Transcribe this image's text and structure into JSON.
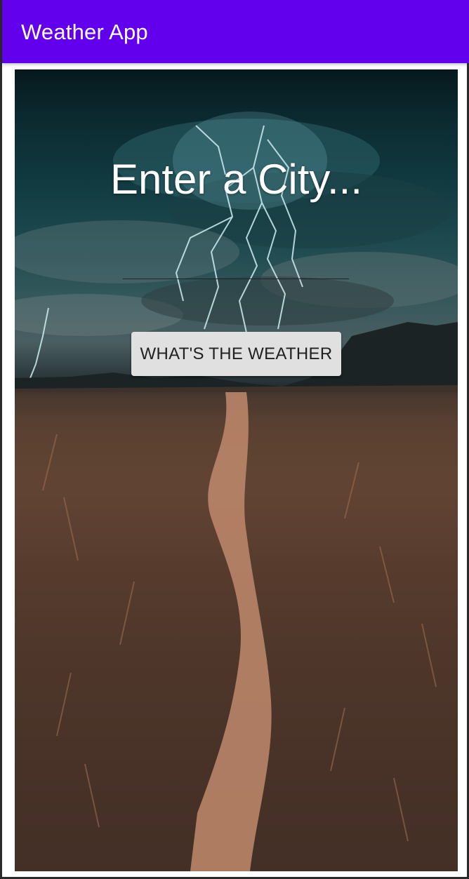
{
  "app_bar": {
    "title": "Weather App",
    "color": "#6200ee"
  },
  "main": {
    "heading": "Enter a City...",
    "city_input": {
      "value": "",
      "placeholder": ""
    },
    "button_label": "WHAT'S THE WEATHER",
    "background_image": "stormy-field-path-image"
  }
}
